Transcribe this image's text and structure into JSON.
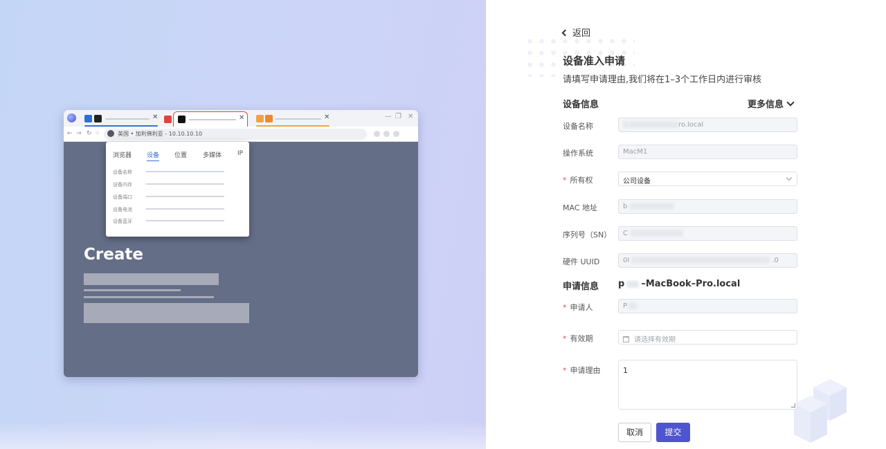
{
  "preview": {
    "address_text": "美国 • 加利佛利亚 - 10.10.10.10",
    "popup_tabs": [
      "浏览器",
      "设备",
      "位置",
      "多媒体",
      "IP"
    ],
    "popup_active_tab": "设备",
    "popup_rows": [
      "设备名称",
      "设备内存",
      "设备端口",
      "设备电池",
      "设备蓝牙"
    ],
    "create_heading": "Create"
  },
  "header": {
    "back_label": "返回",
    "title": "设备准入申请",
    "subtitle": "请填写申请理由,我们将在1–3个工作日内进行审核"
  },
  "device_section": {
    "title": "设备信息",
    "more_label": "更多信息",
    "fields": {
      "device_name": {
        "label": "设备名称",
        "value": "ro.local"
      },
      "os": {
        "label": "操作系统",
        "value": "MacM1"
      },
      "ownership": {
        "label": "所有权",
        "value": "公司设备"
      },
      "mac": {
        "label": "MAC 地址",
        "value": "b"
      },
      "serial": {
        "label": "序列号（SN）",
        "value": "C"
      },
      "uuid": {
        "label": "硬件 UUID",
        "value": "0I",
        "value_end": ".0"
      }
    }
  },
  "apply_section": {
    "title": "申请信息",
    "hostname_prefix": "p",
    "hostname_suffix": "–MacBook–Pro.local",
    "fields": {
      "applicant": {
        "label": "申请人",
        "value": "P"
      },
      "validity": {
        "label": "有效期",
        "placeholder": "请选择有效期"
      },
      "reason": {
        "label": "申请理由",
        "value": "1"
      }
    }
  },
  "actions": {
    "cancel_label": "取消",
    "submit_label": "提交"
  },
  "colors": {
    "primary": "#4f55d0",
    "required": "#e5484d",
    "preview_bg": "#646e87"
  }
}
